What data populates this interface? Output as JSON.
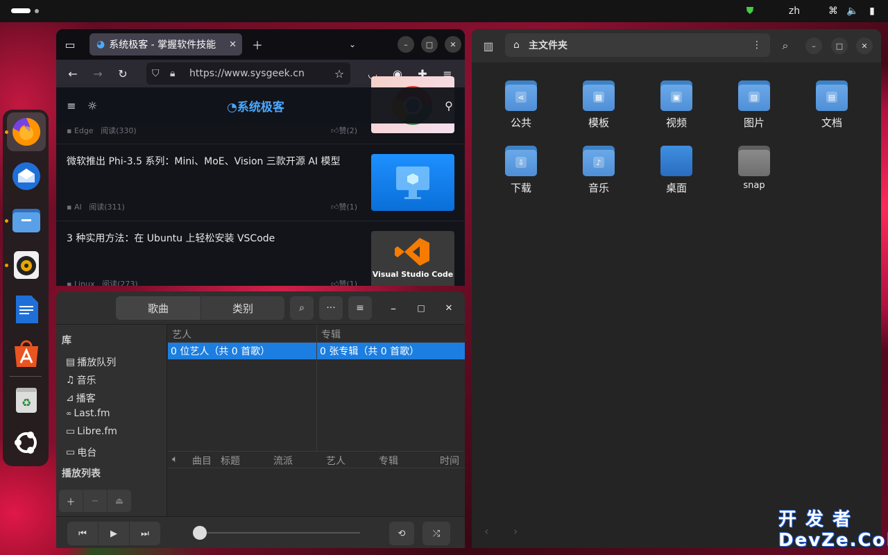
{
  "topbar": {
    "lang": "zh"
  },
  "firefox": {
    "tab_title": "系统极客 - 掌握软件技能",
    "url": "https://www.sysgeek.cn",
    "site_logo": "系统极客",
    "articles": [
      {
        "title": "",
        "tag": "Edge",
        "reads": "阅读(330)",
        "likes": "赞(2)"
      },
      {
        "title": "微软推出 Phi-3.5 系列：Mini、MoE、Vision 三款开源 AI 模型",
        "tag": "AI",
        "reads": "阅读(311)",
        "likes": "赞(1)"
      },
      {
        "title": "3 种实用方法：在 Ubuntu 上轻松安装 VSCode",
        "tag": "Linux",
        "reads": "阅读(273)",
        "likes": "赞(1)",
        "thumb_caption": "Visual Studio Code"
      }
    ]
  },
  "files": {
    "path": "主文件夹",
    "folders": [
      {
        "label": "公共",
        "icon": "share-icon"
      },
      {
        "label": "模板",
        "icon": "template-icon"
      },
      {
        "label": "视频",
        "icon": "video-icon"
      },
      {
        "label": "图片",
        "icon": "image-icon"
      },
      {
        "label": "文档",
        "icon": "document-icon"
      },
      {
        "label": "下载",
        "icon": "download-icon"
      },
      {
        "label": "音乐",
        "icon": "music-icon"
      },
      {
        "label": "桌面",
        "icon": "desktop-icon"
      },
      {
        "label": "snap",
        "icon": "folder-icon"
      }
    ]
  },
  "rhythmbox": {
    "tabs": [
      "歌曲",
      "类别"
    ],
    "library_header": "库",
    "library": [
      "播放队列",
      "音乐",
      "播客",
      "Last.fm",
      "Libre.fm",
      "电台"
    ],
    "playlists_header": "播放列表",
    "browser_headers": {
      "artist": "艺人",
      "album": "专辑"
    },
    "artist_row": "0 位艺人（共 0 首歌）",
    "album_row": "0 张专辑（共 0 首歌）",
    "track_columns": [
      "曲目",
      "标题",
      "流派",
      "艺人",
      "专辑",
      "时间"
    ]
  },
  "watermark": {
    "line1": "开 发 者",
    "line2": "DevZe.CoM"
  }
}
